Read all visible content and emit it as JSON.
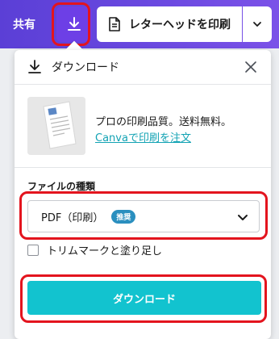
{
  "topbar": {
    "share_label": "共有",
    "print_label": "レターヘッドを印刷"
  },
  "panel": {
    "title": "ダウンロード",
    "promo": {
      "text": "プロの印刷品質。送料無料。",
      "link": "Canvaで印刷を注文"
    },
    "file_type_label": "ファイルの種類",
    "file_type_value": "PDF（印刷）",
    "badge": "推奨",
    "checkbox_label": "トリムマークと塗り足し",
    "checkbox_checked": false,
    "download_button": "ダウンロード"
  },
  "colors": {
    "accent": "#12c3cf",
    "topbar": "#6a49e0",
    "highlight": "#e3141e",
    "link": "#13a3b4"
  }
}
